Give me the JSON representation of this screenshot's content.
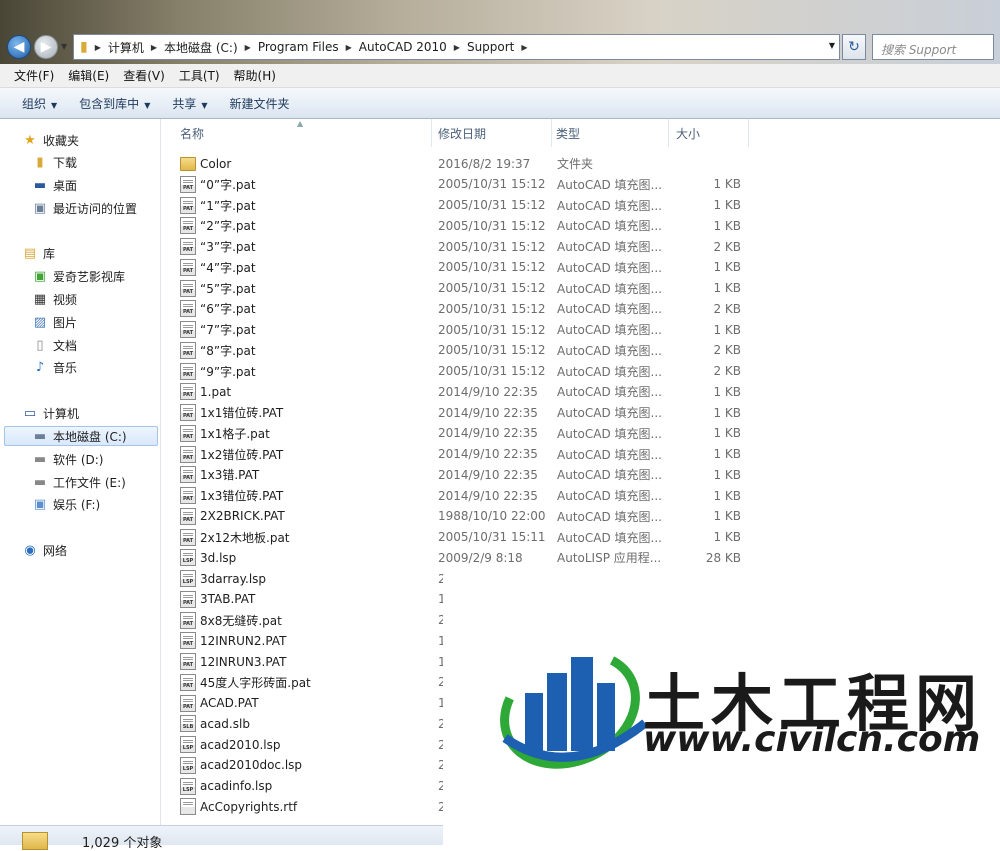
{
  "address": {
    "crumbs": [
      "计算机",
      "本地磁盘 (C:)",
      "Program Files",
      "AutoCAD 2010",
      "Support"
    ],
    "search_placeholder": "搜索 Support"
  },
  "menu": [
    "文件(F)",
    "编辑(E)",
    "查看(V)",
    "工具(T)",
    "帮助(H)"
  ],
  "toolbar": {
    "organize": "组织",
    "include": "包含到库中",
    "share": "共享",
    "newfolder": "新建文件夹"
  },
  "sidebar": {
    "favorites": "收藏夹",
    "fav_items": [
      "下载",
      "桌面",
      "最近访问的位置"
    ],
    "libraries": "库",
    "lib_items": [
      "爱奇艺影视库",
      "视频",
      "图片",
      "文档",
      "音乐"
    ],
    "computer": "计算机",
    "drives": [
      "本地磁盘 (C:)",
      "软件 (D:)",
      "工作文件 (E:)",
      "娱乐 (F:)"
    ],
    "network": "网络"
  },
  "columns": {
    "name": "名称",
    "date": "修改日期",
    "type": "类型",
    "size": "大小"
  },
  "files": [
    {
      "name": "Color",
      "date": "2016/8/2 19:37",
      "type": "文件夹",
      "size": "",
      "icon": "folder-icon"
    },
    {
      "name": "“0”字.pat",
      "date": "2005/10/31 15:12",
      "type": "AutoCAD 填充图...",
      "size": "1 KB",
      "icon": "pat-file-icon"
    },
    {
      "name": "“1”字.pat",
      "date": "2005/10/31 15:12",
      "type": "AutoCAD 填充图...",
      "size": "1 KB",
      "icon": "pat-file-icon"
    },
    {
      "name": "“2”字.pat",
      "date": "2005/10/31 15:12",
      "type": "AutoCAD 填充图...",
      "size": "1 KB",
      "icon": "pat-file-icon"
    },
    {
      "name": "“3”字.pat",
      "date": "2005/10/31 15:12",
      "type": "AutoCAD 填充图...",
      "size": "2 KB",
      "icon": "pat-file-icon"
    },
    {
      "name": "“4”字.pat",
      "date": "2005/10/31 15:12",
      "type": "AutoCAD 填充图...",
      "size": "1 KB",
      "icon": "pat-file-icon"
    },
    {
      "name": "“5”字.pat",
      "date": "2005/10/31 15:12",
      "type": "AutoCAD 填充图...",
      "size": "1 KB",
      "icon": "pat-file-icon"
    },
    {
      "name": "“6”字.pat",
      "date": "2005/10/31 15:12",
      "type": "AutoCAD 填充图...",
      "size": "2 KB",
      "icon": "pat-file-icon"
    },
    {
      "name": "“7”字.pat",
      "date": "2005/10/31 15:12",
      "type": "AutoCAD 填充图...",
      "size": "1 KB",
      "icon": "pat-file-icon"
    },
    {
      "name": "“8”字.pat",
      "date": "2005/10/31 15:12",
      "type": "AutoCAD 填充图...",
      "size": "2 KB",
      "icon": "pat-file-icon"
    },
    {
      "name": "“9”字.pat",
      "date": "2005/10/31 15:12",
      "type": "AutoCAD 填充图...",
      "size": "2 KB",
      "icon": "pat-file-icon"
    },
    {
      "name": "1.pat",
      "date": "2014/9/10 22:35",
      "type": "AutoCAD 填充图...",
      "size": "1 KB",
      "icon": "pat-file-icon"
    },
    {
      "name": "1x1错位砖.PAT",
      "date": "2014/9/10 22:35",
      "type": "AutoCAD 填充图...",
      "size": "1 KB",
      "icon": "pat-file-icon"
    },
    {
      "name": "1x1格子.pat",
      "date": "2014/9/10 22:35",
      "type": "AutoCAD 填充图...",
      "size": "1 KB",
      "icon": "pat-file-icon"
    },
    {
      "name": "1x2错位砖.PAT",
      "date": "2014/9/10 22:35",
      "type": "AutoCAD 填充图...",
      "size": "1 KB",
      "icon": "pat-file-icon"
    },
    {
      "name": "1x3错.PAT",
      "date": "2014/9/10 22:35",
      "type": "AutoCAD 填充图...",
      "size": "1 KB",
      "icon": "pat-file-icon"
    },
    {
      "name": "1x3错位砖.PAT",
      "date": "2014/9/10 22:35",
      "type": "AutoCAD 填充图...",
      "size": "1 KB",
      "icon": "pat-file-icon"
    },
    {
      "name": "2X2BRICK.PAT",
      "date": "1988/10/10 22:00",
      "type": "AutoCAD 填充图...",
      "size": "1 KB",
      "icon": "pat-file-icon"
    },
    {
      "name": "2x12木地板.pat",
      "date": "2005/10/31 15:11",
      "type": "AutoCAD 填充图...",
      "size": "1 KB",
      "icon": "pat-file-icon"
    },
    {
      "name": "3d.lsp",
      "date": "2009/2/9 8:18",
      "type": "AutoLISP 应用程...",
      "size": "28 KB",
      "icon": "lsp-file-icon"
    },
    {
      "name": "3darray.lsp",
      "date": "2",
      "type": "",
      "size": "",
      "icon": "lsp-file-icon"
    },
    {
      "name": "3TAB.PAT",
      "date": "1",
      "type": "",
      "size": "",
      "icon": "pat-file-icon"
    },
    {
      "name": "8x8无缝砖.pat",
      "date": "2",
      "type": "",
      "size": "",
      "icon": "pat-file-icon"
    },
    {
      "name": "12INRUN2.PAT",
      "date": "1",
      "type": "",
      "size": "",
      "icon": "pat-file-icon"
    },
    {
      "name": "12INRUN3.PAT",
      "date": "1",
      "type": "",
      "size": "",
      "icon": "pat-file-icon"
    },
    {
      "name": "45度人字形砖面.pat",
      "date": "2",
      "type": "",
      "size": "",
      "icon": "pat-file-icon"
    },
    {
      "name": "ACAD.PAT",
      "date": "1",
      "type": "",
      "size": "",
      "icon": "pat-file-icon"
    },
    {
      "name": "acad.slb",
      "date": "2",
      "type": "",
      "size": "",
      "icon": "slb-file-icon"
    },
    {
      "name": "acad2010.lsp",
      "date": "2",
      "type": "",
      "size": "",
      "icon": "lsp-file-icon"
    },
    {
      "name": "acad2010doc.lsp",
      "date": "2",
      "type": "",
      "size": "",
      "icon": "lsp-file-icon"
    },
    {
      "name": "acadinfo.lsp",
      "date": "2",
      "type": "",
      "size": "",
      "icon": "lsp-file-icon"
    },
    {
      "name": "AcCopyrights.rtf",
      "date": "2",
      "type": "",
      "size": "",
      "icon": "rtf-file-icon"
    }
  ],
  "status": {
    "count": "1,029 个对象"
  },
  "watermark": {
    "title": "土木工程网",
    "url": "www.civilcn.com"
  }
}
